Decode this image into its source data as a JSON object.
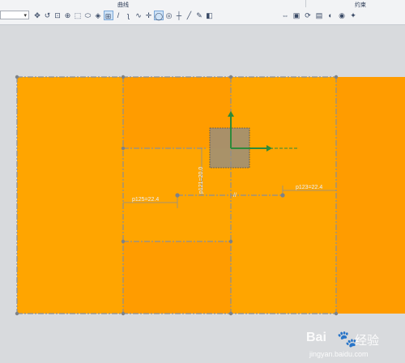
{
  "toolbar": {
    "groups": {
      "sketch": "曲线",
      "constraint": "约束"
    },
    "tools": [
      {
        "name": "pan-icon",
        "glyph": "✥"
      },
      {
        "name": "rebuild-icon",
        "glyph": "↺"
      },
      {
        "name": "snap-icon",
        "glyph": "⊡"
      },
      {
        "name": "sketch-origin-icon",
        "glyph": "⊕"
      },
      {
        "name": "select-box-icon",
        "glyph": "⬚"
      },
      {
        "name": "profile-icon",
        "glyph": "⬭"
      },
      {
        "name": "block-icon",
        "glyph": "◈"
      },
      {
        "name": "grid-icon",
        "glyph": "⊞"
      },
      {
        "name": "line-icon",
        "glyph": "/"
      },
      {
        "name": "arc-icon",
        "glyph": "ʅ"
      },
      {
        "name": "studio-spline-icon",
        "glyph": "∿"
      },
      {
        "name": "point-icon",
        "glyph": "✛"
      },
      {
        "name": "circle-icon",
        "glyph": "◯"
      },
      {
        "name": "ellipse-icon",
        "glyph": "◎"
      },
      {
        "name": "point-on-curve-icon",
        "glyph": "┼"
      },
      {
        "name": "line-tool-icon",
        "glyph": "╱"
      },
      {
        "name": "offset-icon",
        "glyph": "✎"
      },
      {
        "name": "mirror-icon",
        "glyph": "◧"
      }
    ],
    "constraint_tools": [
      {
        "name": "dimension-icon",
        "glyph": "⇔"
      },
      {
        "name": "geometric-constraint-icon",
        "glyph": "▣"
      },
      {
        "name": "auto-constrain-icon",
        "glyph": "⟳"
      },
      {
        "name": "table-icon",
        "glyph": "▤"
      },
      {
        "name": "shade-icon",
        "glyph": "◐"
      },
      {
        "name": "display-icon",
        "glyph": "◉"
      },
      {
        "name": "settings-icon",
        "glyph": "✦"
      }
    ]
  },
  "dimensions": {
    "d1": "p125=22.4",
    "d2": "p121=20.0",
    "d3": "p123=22.4",
    "slash": "//"
  },
  "colors": {
    "panel_light": "#FFA500",
    "panel_dark": "#FF9C00",
    "construction": "#8a8f96",
    "axis_x": "#2d8a3a",
    "axis_y": "#2d8a3a"
  },
  "watermark": {
    "brand": "Bai",
    "name": "经验",
    "url": "jingyan.baidu.com"
  }
}
